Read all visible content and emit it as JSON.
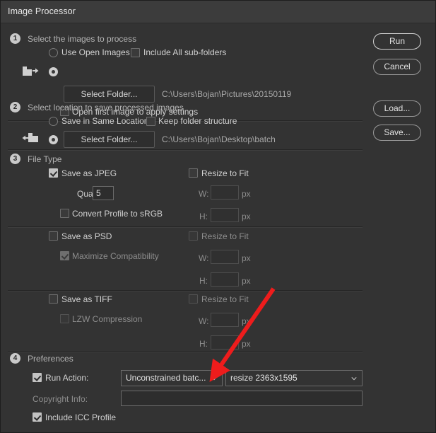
{
  "window": {
    "title": "Image Processor"
  },
  "steps": {
    "one": {
      "num": "1",
      "label": "Select the images to process"
    },
    "two": {
      "num": "2",
      "label": "Select location to save processed images"
    },
    "three": {
      "num": "3",
      "label": "File Type"
    },
    "four": {
      "num": "4",
      "label": "Preferences"
    }
  },
  "section1": {
    "use_open_images": "Use Open Images",
    "include_all_subfolders": "Include All sub-folders",
    "select_folder_button": "Select Folder...",
    "folder_path": "C:\\Users\\Bojan\\Pictures\\20150119",
    "open_first_image": "Open first image to apply settings"
  },
  "section2": {
    "save_in_same_location": "Save in Same Location",
    "keep_folder_structure": "Keep folder structure",
    "select_folder_button": "Select Folder...",
    "folder_path": "C:\\Users\\Bojan\\Desktop\\batch"
  },
  "section3": {
    "jpeg": {
      "save_as_label": "Save as JPEG",
      "quality_label": "Quality:",
      "quality_value": "5",
      "convert_profile_label": "Convert Profile to sRGB",
      "resize_to_fit_label": "Resize to Fit",
      "w_label": "W:",
      "w_value": "",
      "h_label": "H:",
      "h_value": "",
      "px_label": "px"
    },
    "psd": {
      "save_as_label": "Save as PSD",
      "maximize_compat_label": "Maximize Compatibility",
      "resize_to_fit_label": "Resize to Fit",
      "w_label": "W:",
      "w_value": "",
      "h_label": "H:",
      "h_value": "",
      "px_label": "px"
    },
    "tiff": {
      "save_as_label": "Save as TIFF",
      "lzw_label": "LZW Compression",
      "resize_to_fit_label": "Resize to Fit",
      "w_label": "W:",
      "w_value": "",
      "h_label": "H:",
      "h_value": "",
      "px_label": "px"
    }
  },
  "section4": {
    "run_action_label": "Run Action:",
    "action_set_value": "Unconstrained batc...",
    "action_value": "resize 2363x1595",
    "copyright_label": "Copyright Info:",
    "copyright_value": "",
    "include_icc_label": "Include ICC Profile"
  },
  "buttons": {
    "run": "Run",
    "cancel": "Cancel",
    "load": "Load...",
    "save": "Save..."
  },
  "icons": {
    "folder_out": "folder-out-icon",
    "folder_in": "folder-in-icon",
    "chevron": "chevron-down-icon",
    "annotation": "red-arrow-annotation"
  },
  "colors": {
    "window_bg": "#333333",
    "titlebar_bg": "#3c3c3c",
    "accent_annotation": "#ee1c1c",
    "text": "#d2d2d2",
    "text_dim": "#8d8d8d"
  }
}
